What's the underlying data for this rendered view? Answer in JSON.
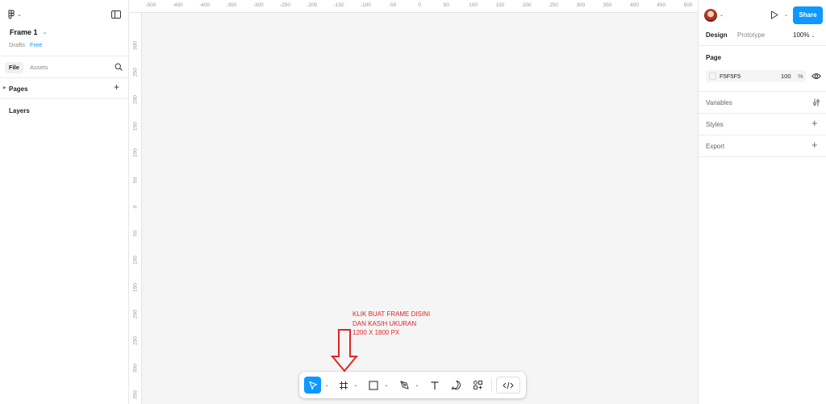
{
  "file": {
    "name": "Frame 1",
    "location": "Drafts",
    "plan": "Free"
  },
  "left_panel": {
    "tab_file": "File",
    "tab_assets": "Assets",
    "pages_label": "Pages",
    "layers_label": "Layers"
  },
  "ruler": {
    "top": [
      "-500",
      "-450",
      "-400",
      "-350",
      "-300",
      "-250",
      "-200",
      "-150",
      "-100",
      "-50",
      "0",
      "50",
      "100",
      "150",
      "200",
      "250",
      "300",
      "350",
      "400",
      "450",
      "500"
    ],
    "left": [
      "300",
      "250",
      "200",
      "150",
      "100",
      "50",
      "0",
      "50",
      "100",
      "150",
      "200",
      "250",
      "300",
      "350"
    ]
  },
  "annotation": {
    "line1": "KLIK BUAT FRAME DISINI",
    "line2": "DAN KASIH UKURAN",
    "line3": "1200 X 1800 PX",
    "color": "#e02424"
  },
  "right_panel": {
    "share_label": "Share",
    "tab_design": "Design",
    "tab_prototype": "Prototype",
    "zoom": "100%",
    "page_label": "Page",
    "page_fill_hex": "F5F5F5",
    "page_fill_opacity": "100",
    "page_fill_unit": "%",
    "variables_label": "Variables",
    "styles_label": "Styles",
    "export_label": "Export"
  },
  "help_label": "?",
  "colors": {
    "accent": "#0d99ff",
    "canvas": "#f5f5f5"
  }
}
